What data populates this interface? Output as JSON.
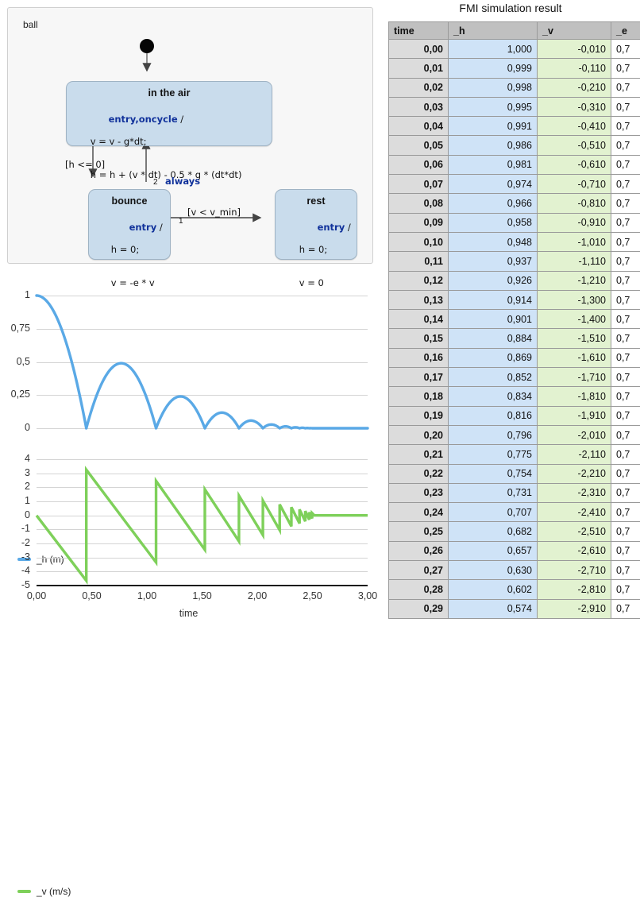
{
  "diagram": {
    "region_label": "ball",
    "states": [
      {
        "name": "in the air",
        "trigger": "entry,oncycle",
        "slash": " /",
        "line1": "v = v - g*dt;",
        "line2": "h = h + (v * dt) - 0.5 * g * (dt*dt)"
      },
      {
        "name": "bounce",
        "trigger": "entry",
        "slash": " /",
        "line1": "h = 0;",
        "line2": "v = -e * v"
      },
      {
        "name": "rest",
        "trigger": "entry",
        "slash": " /",
        "line1": "h = 0;",
        "line2": "v = 0"
      }
    ],
    "transitions": [
      {
        "label": "[h <= 0]",
        "priority": ""
      },
      {
        "label": "always",
        "priority": "2"
      },
      {
        "label": "[v < v_min]",
        "priority": "1"
      }
    ]
  },
  "chart_data": [
    {
      "type": "line",
      "title": "",
      "legend": "_h (m)",
      "legend_position": "top-left",
      "color": "#5aa9e6",
      "xlabel": "",
      "ylabel": "",
      "grid": true,
      "xlim": [
        0,
        3
      ],
      "ylim": [
        0,
        1
      ],
      "yticks": [
        "1",
        "0,75",
        "0,5",
        "0,25",
        "0"
      ],
      "ytick_values": [
        1,
        0.75,
        0.5,
        0.25,
        0
      ],
      "xticks": [
        "0,00",
        "0,50",
        "1,00",
        "1,50",
        "2,00",
        "2,50",
        "3,00"
      ],
      "xtick_values": [
        0,
        0.5,
        1,
        1.5,
        2,
        2.5,
        3
      ],
      "description": "bouncing ball height, damped parabolic arcs decaying to 0",
      "bounce_times": [
        0.451,
        1.083,
        1.525,
        1.834,
        2.051,
        2.203,
        2.309,
        2.383,
        2.435,
        2.471,
        2.497
      ],
      "peak_times": [
        0.0,
        0.767,
        1.304,
        1.679,
        1.942,
        2.127,
        2.256,
        2.346,
        2.409,
        2.453,
        2.484
      ],
      "peak_values": [
        1.0,
        0.49,
        0.24,
        0.1176,
        0.0576,
        0.0282,
        0.0138,
        0.0068,
        0.0033,
        0.0016,
        0.0008
      ]
    },
    {
      "type": "line",
      "title": "",
      "legend": "_v (m/s)",
      "legend_position": "top-left",
      "color": "#7ed05a",
      "xlabel": "time",
      "ylabel": "",
      "grid": true,
      "xlim": [
        0,
        3
      ],
      "ylim": [
        -5,
        4
      ],
      "yticks": [
        "4",
        "3",
        "2",
        "1",
        "0",
        "-1",
        "-2",
        "-3",
        "-4",
        "-5"
      ],
      "ytick_values": [
        4,
        3,
        2,
        1,
        0,
        -1,
        -2,
        -3,
        -4,
        -5
      ],
      "xticks": [
        "0,00",
        "0,50",
        "1,00",
        "1,50",
        "2,00",
        "2,50",
        "3,00"
      ],
      "xtick_values": [
        0,
        0.5,
        1,
        1.5,
        2,
        2.5,
        3
      ],
      "description": "sawtooth velocity: linear decrease under gravity, jump up at each bounce (restitution 0.7)",
      "bounce_times": [
        0.451,
        1.083,
        1.525,
        1.834,
        2.051,
        2.203,
        2.309,
        2.383,
        2.435,
        2.471,
        2.497
      ],
      "impact_velocities": [
        -4.65,
        -3.35,
        -2.45,
        -1.85,
        -1.4,
        -1.05,
        -0.78,
        -0.58,
        -0.42,
        -0.31,
        -0.22
      ],
      "rebound_velocities": [
        3.25,
        2.45,
        1.85,
        1.4,
        1.05,
        0.78,
        0.58,
        0.42,
        0.31,
        0.22,
        0.16
      ]
    }
  ],
  "table": {
    "title": "FMI simulation result",
    "columns": [
      "time",
      "_h",
      "_v",
      "_e"
    ],
    "rows": [
      [
        "0,00",
        "1,000",
        "-0,010",
        "0,7"
      ],
      [
        "0,01",
        "0,999",
        "-0,110",
        "0,7"
      ],
      [
        "0,02",
        "0,998",
        "-0,210",
        "0,7"
      ],
      [
        "0,03",
        "0,995",
        "-0,310",
        "0,7"
      ],
      [
        "0,04",
        "0,991",
        "-0,410",
        "0,7"
      ],
      [
        "0,05",
        "0,986",
        "-0,510",
        "0,7"
      ],
      [
        "0,06",
        "0,981",
        "-0,610",
        "0,7"
      ],
      [
        "0,07",
        "0,974",
        "-0,710",
        "0,7"
      ],
      [
        "0,08",
        "0,966",
        "-0,810",
        "0,7"
      ],
      [
        "0,09",
        "0,958",
        "-0,910",
        "0,7"
      ],
      [
        "0,10",
        "0,948",
        "-1,010",
        "0,7"
      ],
      [
        "0,11",
        "0,937",
        "-1,110",
        "0,7"
      ],
      [
        "0,12",
        "0,926",
        "-1,210",
        "0,7"
      ],
      [
        "0,13",
        "0,914",
        "-1,300",
        "0,7"
      ],
      [
        "0,14",
        "0,901",
        "-1,400",
        "0,7"
      ],
      [
        "0,15",
        "0,884",
        "-1,510",
        "0,7"
      ],
      [
        "0,16",
        "0,869",
        "-1,610",
        "0,7"
      ],
      [
        "0,17",
        "0,852",
        "-1,710",
        "0,7"
      ],
      [
        "0,18",
        "0,834",
        "-1,810",
        "0,7"
      ],
      [
        "0,19",
        "0,816",
        "-1,910",
        "0,7"
      ],
      [
        "0,20",
        "0,796",
        "-2,010",
        "0,7"
      ],
      [
        "0,21",
        "0,775",
        "-2,110",
        "0,7"
      ],
      [
        "0,22",
        "0,754",
        "-2,210",
        "0,7"
      ],
      [
        "0,23",
        "0,731",
        "-2,310",
        "0,7"
      ],
      [
        "0,24",
        "0,707",
        "-2,410",
        "0,7"
      ],
      [
        "0,25",
        "0,682",
        "-2,510",
        "0,7"
      ],
      [
        "0,26",
        "0,657",
        "-2,610",
        "0,7"
      ],
      [
        "0,27",
        "0,630",
        "-2,710",
        "0,7"
      ],
      [
        "0,28",
        "0,602",
        "-2,810",
        "0,7"
      ],
      [
        "0,29",
        "0,574",
        "-2,910",
        "0,7"
      ]
    ]
  },
  "colors": {
    "h_series": "#5aa9e6",
    "v_series": "#7ed05a",
    "state_fill": "#c9dcec",
    "state_stroke": "#9fb3c4",
    "keyword": "#11329b",
    "table_header": "#c0c0c0",
    "col_time": "#dcdcdc",
    "col_h": "#cfe3f7",
    "col_v": "#e2f2d0"
  }
}
